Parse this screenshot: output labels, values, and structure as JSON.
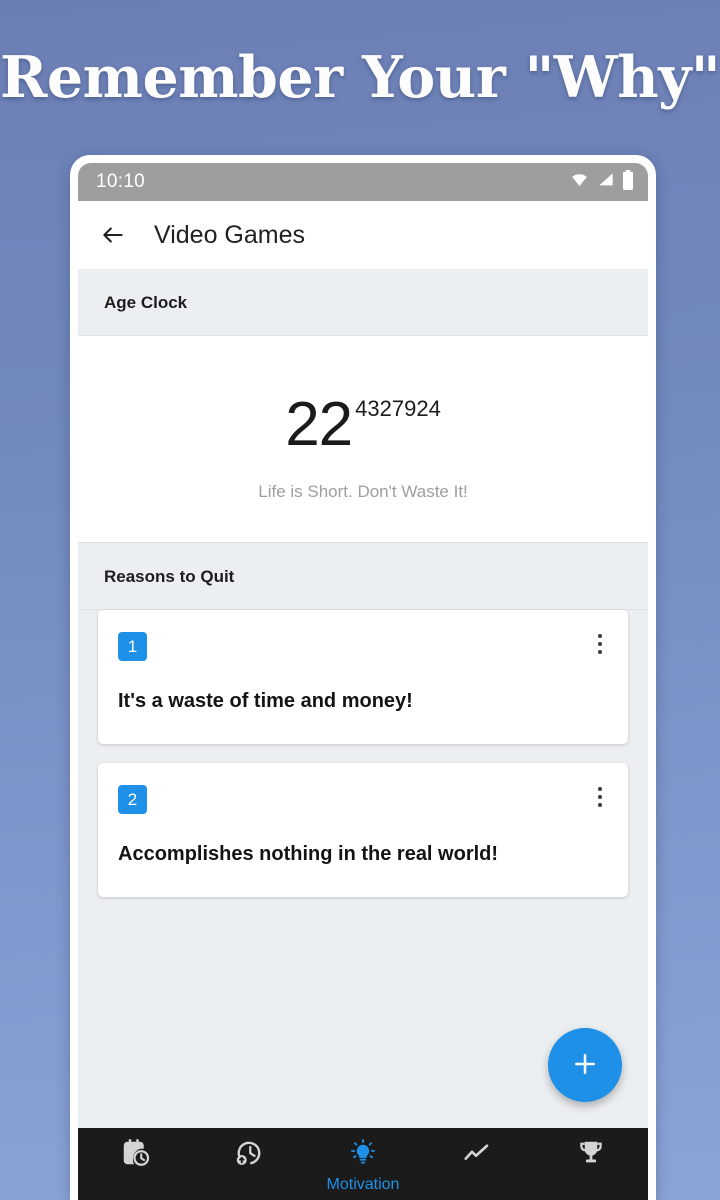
{
  "promo": {
    "headline": "Remember Your \"Why\""
  },
  "status_bar": {
    "time": "10:10",
    "icons": [
      "wifi-icon",
      "signal-icon",
      "battery-icon"
    ],
    "background_color": "#9e9e9e"
  },
  "app_bar": {
    "back_icon": "back-arrow-icon",
    "title": "Video Games"
  },
  "age_clock": {
    "section_title": "Age Clock",
    "value": "22",
    "fraction": "4327924",
    "caption": "Life is Short. Don't Waste It!"
  },
  "reasons": {
    "section_title": "Reasons to Quit",
    "items": [
      {
        "number": "1",
        "text": "It's a waste of time and money!",
        "menu_icon": "overflow-menu-icon"
      },
      {
        "number": "2",
        "text": "Accomplishes nothing in the real world!",
        "menu_icon": "overflow-menu-icon"
      }
    ]
  },
  "fab": {
    "icon": "plus-icon",
    "color": "#1e90e8"
  },
  "bottom_nav": {
    "active_index": 2,
    "active_color": "#1e90e8",
    "inactive_color": "#d4d4d4",
    "items": [
      {
        "icon": "calendar-clock-icon",
        "label": ""
      },
      {
        "icon": "clock-arrow-up-icon",
        "label": ""
      },
      {
        "icon": "lightbulb-icon",
        "label": "Motivation"
      },
      {
        "icon": "trending-up-icon",
        "label": ""
      },
      {
        "icon": "trophy-icon",
        "label": ""
      }
    ]
  }
}
